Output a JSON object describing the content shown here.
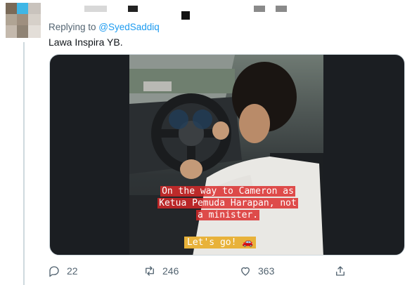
{
  "reply": {
    "prefix": "Replying to ",
    "handle": "@SyedSaddiq"
  },
  "tweet": {
    "text": "Lawa Inspira YB."
  },
  "media": {
    "caption_lines": [
      "On the way to Cameron as",
      "Ketua Pemuda Harapan, not",
      "a minister."
    ],
    "cta": "Let's go! 🚗"
  },
  "actions": {
    "replies": "22",
    "retweets": "246",
    "likes": "363"
  },
  "icons": {
    "reply": "reply-icon",
    "retweet": "retweet-icon",
    "like": "heart-icon",
    "share": "share-icon"
  },
  "colors": {
    "link": "#1d9bf0",
    "muted": "#536471",
    "caption_bg": "#dc2828",
    "cta_bg": "#e8b23a"
  }
}
